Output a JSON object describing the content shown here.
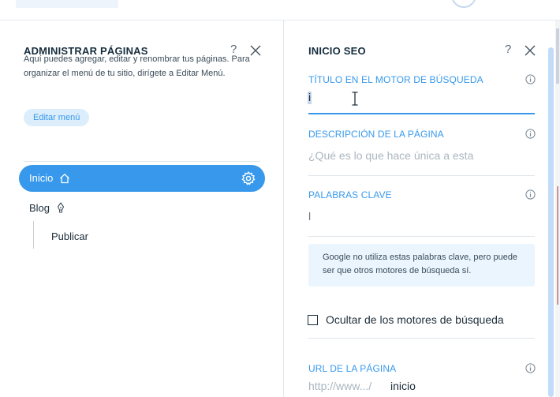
{
  "left_panel": {
    "title": "ADMINISTRAR PÁGINAS",
    "help": "?",
    "description": "Aquí puedes agregar, editar y renombrar tus páginas. Para organizar el menú de tu sitio, dirígete a Editar Menú.",
    "edit_menu_label": "Editar menú",
    "pages": [
      {
        "label": "Inicio",
        "icon": "home-icon",
        "selected": true
      },
      {
        "label": "Blog",
        "icon": "pen-icon",
        "selected": false
      },
      {
        "label": "Publicar",
        "icon": "",
        "selected": false
      }
    ]
  },
  "right_panel": {
    "title": "INICIO SEO",
    "help": "?",
    "seo_title": {
      "label": "TÍTULO EN EL MOTOR DE BÚSQUEDA",
      "value": "i"
    },
    "page_description": {
      "label": "DESCRIPCIÓN DE LA PÁGINA",
      "placeholder": "¿Qué es lo que hace única a esta"
    },
    "keywords": {
      "label": "PALABRAS CLAVE",
      "value": "l"
    },
    "keywords_note": "Google no utiliza estas palabras clave, pero puede ser que otros motores de búsqueda sí.",
    "hide_checkbox": {
      "label": "Ocultar de los motores de búsqueda",
      "checked": false
    },
    "page_url": {
      "label": "URL DE LA PÁGINA",
      "prefix": "http://www.../",
      "slug": "inicio"
    }
  },
  "colors": {
    "accent": "#3899ec",
    "accent_light": "#dceefc",
    "note_bg": "#eaf5fe",
    "title_text": "#162d3d"
  }
}
